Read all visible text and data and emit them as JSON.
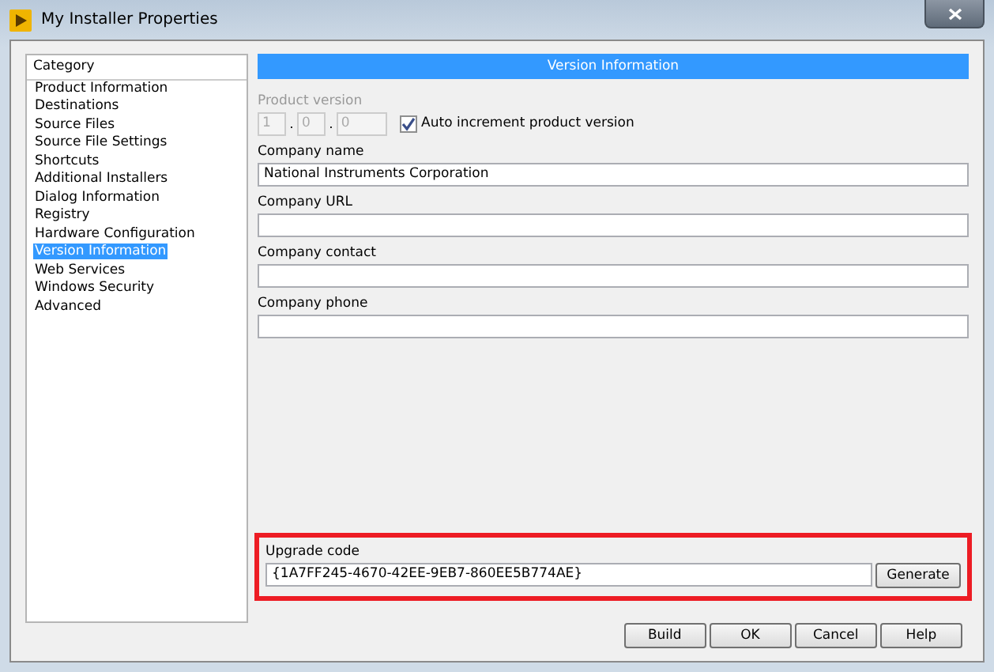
{
  "window": {
    "title": "My Installer Properties"
  },
  "category": {
    "header": "Category",
    "items": [
      {
        "label": "Product Information",
        "selected": false
      },
      {
        "label": "Destinations",
        "selected": false
      },
      {
        "label": "Source Files",
        "selected": false
      },
      {
        "label": "Source File Settings",
        "selected": false
      },
      {
        "label": "Shortcuts",
        "selected": false
      },
      {
        "label": "Additional Installers",
        "selected": false
      },
      {
        "label": "Dialog Information",
        "selected": false
      },
      {
        "label": "Registry",
        "selected": false
      },
      {
        "label": "Hardware Configuration",
        "selected": false
      },
      {
        "label": "Version Information",
        "selected": true
      },
      {
        "label": "Web Services",
        "selected": false
      },
      {
        "label": "Windows Security",
        "selected": false
      },
      {
        "label": "Advanced",
        "selected": false
      }
    ]
  },
  "section_title": "Version Information",
  "product_version": {
    "label": "Product version",
    "disabled": true,
    "parts": [
      "1",
      "0",
      "0"
    ],
    "separators": [
      ".",
      "."
    ],
    "auto_increment": {
      "label": "Auto increment product version",
      "checked": true
    }
  },
  "fields": [
    {
      "label": "Company name",
      "value": "National Instruments Corporation"
    },
    {
      "label": "Company URL"
    },
    {
      "label": "Company contact"
    },
    {
      "label": "Company phone"
    }
  ],
  "upgrade": {
    "label": "Upgrade code",
    "value": "{1A7FF245-4670-42EE-9EB7-860EE5B774AE}",
    "highlighted": true,
    "button": "Generate"
  },
  "buttons": [
    "Build",
    "OK",
    "Cancel",
    "Help"
  ]
}
